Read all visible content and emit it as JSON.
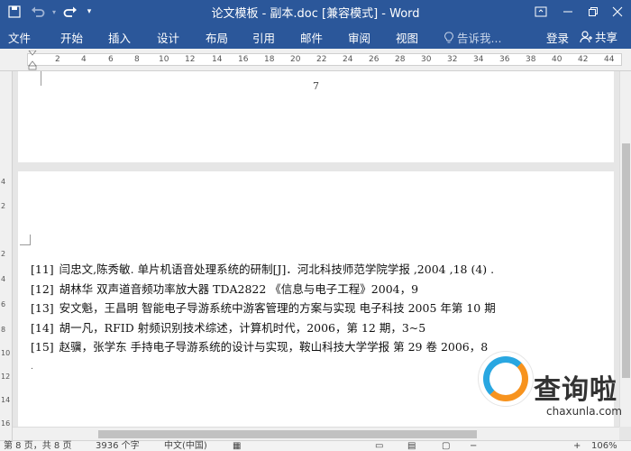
{
  "titlebar": {
    "title": "论文模板 - 副本.doc [兼容模式] - Word",
    "undo_icon": "undo-icon",
    "redo_icon": "redo-icon",
    "customize_icon": "dropdown-icon",
    "ribbon_display_icon": "ribbon-display-icon",
    "minimize_icon": "minimize-icon",
    "restore_icon": "restore-icon",
    "close_icon": "close-icon"
  },
  "ribbon": {
    "tabs": [
      {
        "label": "文件"
      },
      {
        "label": "开始"
      },
      {
        "label": "插入"
      },
      {
        "label": "设计"
      },
      {
        "label": "布局"
      },
      {
        "label": "引用"
      },
      {
        "label": "邮件"
      },
      {
        "label": "审阅"
      },
      {
        "label": "视图"
      }
    ],
    "tell_me": "告诉我...",
    "login": "登录",
    "share": "共享"
  },
  "ruler": {
    "ticks": [
      "2",
      "4",
      "6",
      "8",
      "10",
      "12",
      "14",
      "16",
      "18",
      "20",
      "22",
      "24",
      "26",
      "28",
      "30",
      "32",
      "34",
      "36",
      "38",
      "40",
      "42",
      "44"
    ]
  },
  "vruler": {
    "ticks": [
      "4",
      "2",
      "2",
      "4",
      "6",
      "8",
      "10",
      "12",
      "14",
      "16"
    ]
  },
  "document": {
    "page_number": "7",
    "references": [
      {
        "num": "[11]",
        "text": "闫忠文,陈秀敏. 单片机语音处理系统的研制[J]．河北科技师范学院学报 ,2004 ,18 (4) ."
      },
      {
        "num": "[12]",
        "text": "胡林华 双声道音频功率放大器 TDA2822 《信息与电子工程》2004，9"
      },
      {
        "num": "[13]",
        "text": "安文魁，王昌明 智能电子导游系统中游客管理的方案与实现 电子科技 2005 年第 10 期"
      },
      {
        "num": "[14]",
        "text": "胡一凡，RFID 射频识别技术综述，计算机时代，2006，第 12 期，3~5"
      },
      {
        "num": "[15]",
        "text": "赵骥，张学东 手持电子导游系统的设计与实现，鞍山科技大学学报 第 29 卷 2006，8"
      }
    ]
  },
  "statusbar": {
    "page": "第 8 页，共 8 页",
    "words": "3936 个字",
    "language": "中文(中国)",
    "zoom": "106%"
  },
  "watermark": {
    "name": "查询啦",
    "url": "chaxunla.com"
  }
}
